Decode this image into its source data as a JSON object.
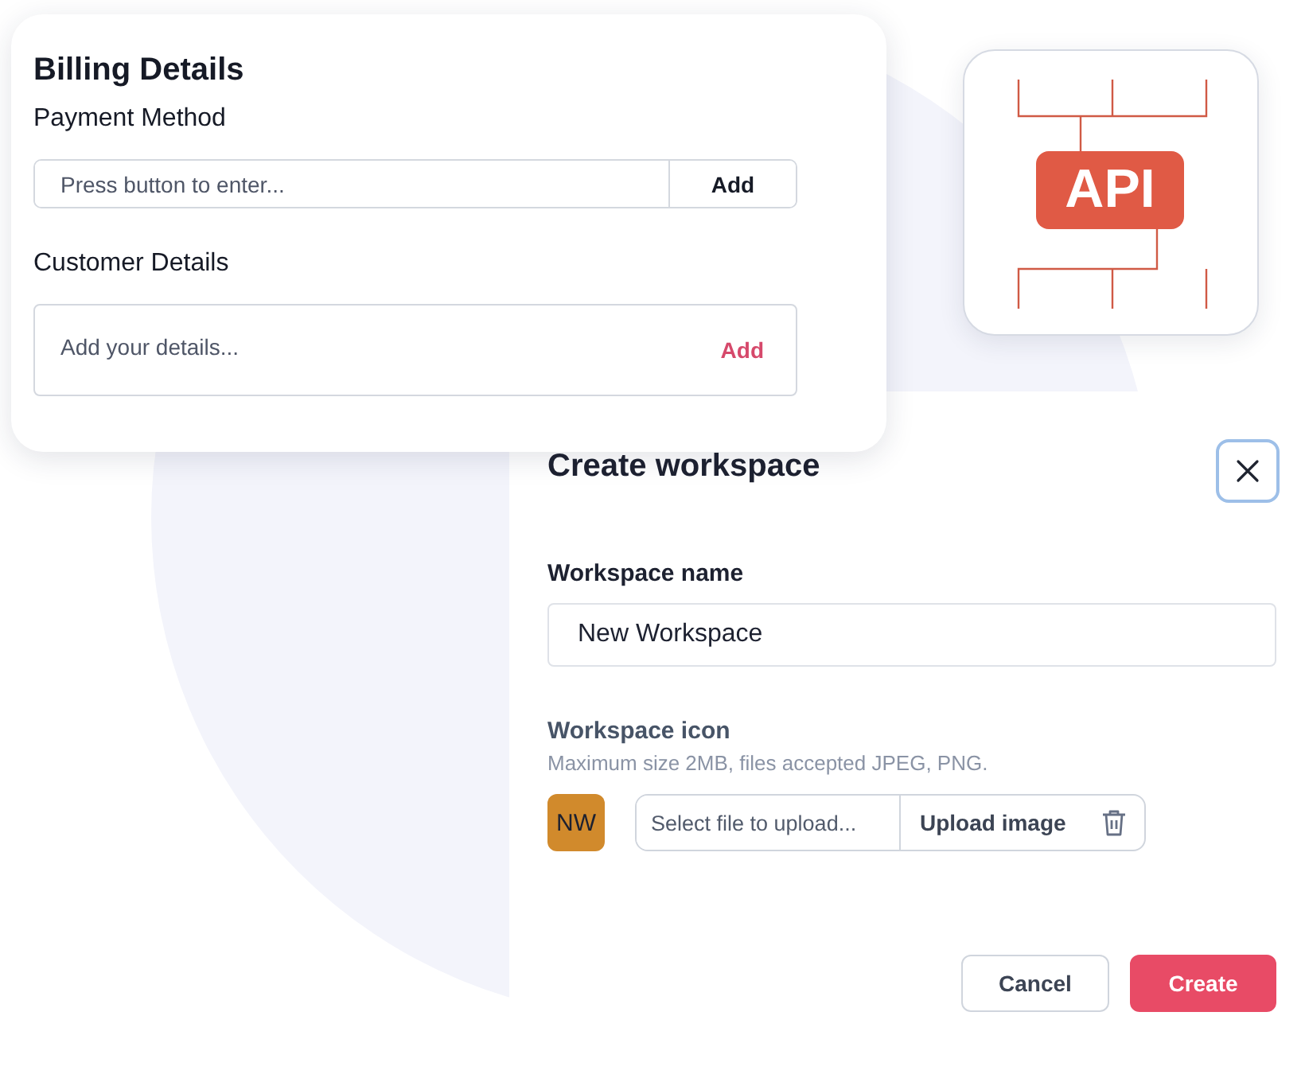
{
  "billing_card": {
    "title": "Billing Details",
    "payment_method": {
      "label": "Payment Method",
      "placeholder": "Press button to enter...",
      "button": "Add"
    },
    "customer_details": {
      "label": "Customer Details",
      "placeholder": "Add your details...",
      "button": "Add"
    }
  },
  "api_card": {
    "badge": "API"
  },
  "dialog": {
    "title": "Create workspace",
    "name_field": {
      "label": "Workspace name",
      "value": "New Workspace"
    },
    "icon_field": {
      "label": "Workspace icon",
      "hint": "Maximum size 2MB, files accepted JPEG, PNG.",
      "avatar": "NW",
      "placeholder": "Select file to upload...",
      "upload_button": "Upload image"
    },
    "buttons": [
      {
        "label": "Cancel",
        "kind": "secondary"
      },
      {
        "label": "Create",
        "kind": "primary"
      }
    ]
  }
}
